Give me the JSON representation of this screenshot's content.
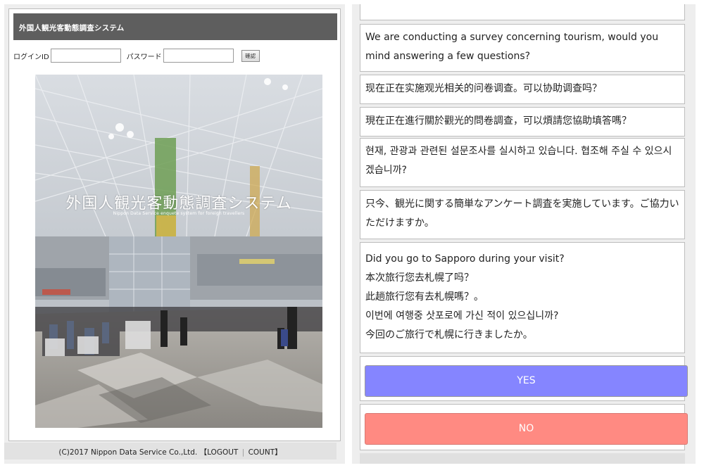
{
  "left": {
    "title_bar": "外国人観光客動態調査システム",
    "login": {
      "id_label": "ログインID",
      "id_value": "",
      "password_label": "パスワード",
      "password_value": "",
      "confirm_label": "確認"
    },
    "hero": {
      "title": "外国人観光客動態調査システム",
      "subtitle": "Nippon Data Service enquete system for foreign travellers"
    },
    "footer": {
      "copyright": "(C)2017 Nippon Data Service Co.,Ltd.",
      "bracket_open": "【",
      "logout": "LOGOUT",
      "separator": "|",
      "count": "COUNT",
      "bracket_close": "】"
    }
  },
  "right": {
    "intro_en": "We are conducting a survey concerning tourism, would you mind answering a few questions?",
    "intro_zh_cn": "现在正在实施观光相关的问卷调查。可以协助调查吗？",
    "intro_zh_tw": "現在正在進行關於觀光的問卷調查，可以煩請您協助填答嗎？",
    "intro_ko": "현재, 관광과 관련된 설문조사를 실시하고 있습니다. 협조해 주실 수 있으시겠습니까?",
    "intro_ja": "只今、観光に関する簡単なアンケート調査を実施しています。ご協力いただけますか。",
    "question": {
      "en": "Did you go to Sapporo during your visit?",
      "zh_cn": "本次旅行您去札幌了吗？",
      "zh_tw": "此趟旅行您有去札幌嗎？。",
      "ko": "이번에 여행중 삿포로에 가신 적이 있으십니까?",
      "ja": "今回のご旅行で札幌に行きましたか。"
    },
    "yes_label": "YES",
    "no_label": "NO"
  },
  "colors": {
    "title_bar": "#5e5e5e",
    "yes_button": "#8585ff",
    "no_button": "#ff8a82",
    "panel_bg": "#eeeeee"
  }
}
